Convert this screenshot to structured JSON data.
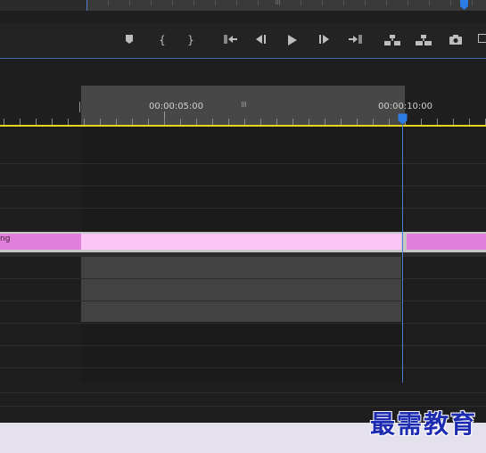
{
  "toolbar": {
    "buttons": [
      {
        "name": "add-marker",
        "icon": "marker-icon"
      },
      {
        "name": "mark-in",
        "icon": "mark-in-icon",
        "glyph": "{"
      },
      {
        "name": "mark-out",
        "icon": "mark-out-icon",
        "glyph": "}"
      },
      {
        "name": "go-to-in",
        "icon": "go-to-in-icon"
      },
      {
        "name": "step-back",
        "icon": "step-back-icon"
      },
      {
        "name": "play",
        "icon": "play-icon"
      },
      {
        "name": "step-forward",
        "icon": "step-forward-icon"
      },
      {
        "name": "go-to-out",
        "icon": "go-to-out-icon"
      },
      {
        "name": "lift",
        "icon": "lift-icon"
      },
      {
        "name": "extract",
        "icon": "extract-icon"
      },
      {
        "name": "export-frame",
        "icon": "camera-icon"
      }
    ]
  },
  "ruler": {
    "timecode_1": "00:00:05:00",
    "timecode_2": "00:00:10:00"
  },
  "track": {
    "clip_label": "ng"
  },
  "watermark": {
    "text": "最需教育"
  },
  "colors": {
    "accent": "#4a82d8",
    "work_line": "#e7d61d",
    "clip_selected": "#fbc5f6",
    "clip": "#e27fdc"
  }
}
